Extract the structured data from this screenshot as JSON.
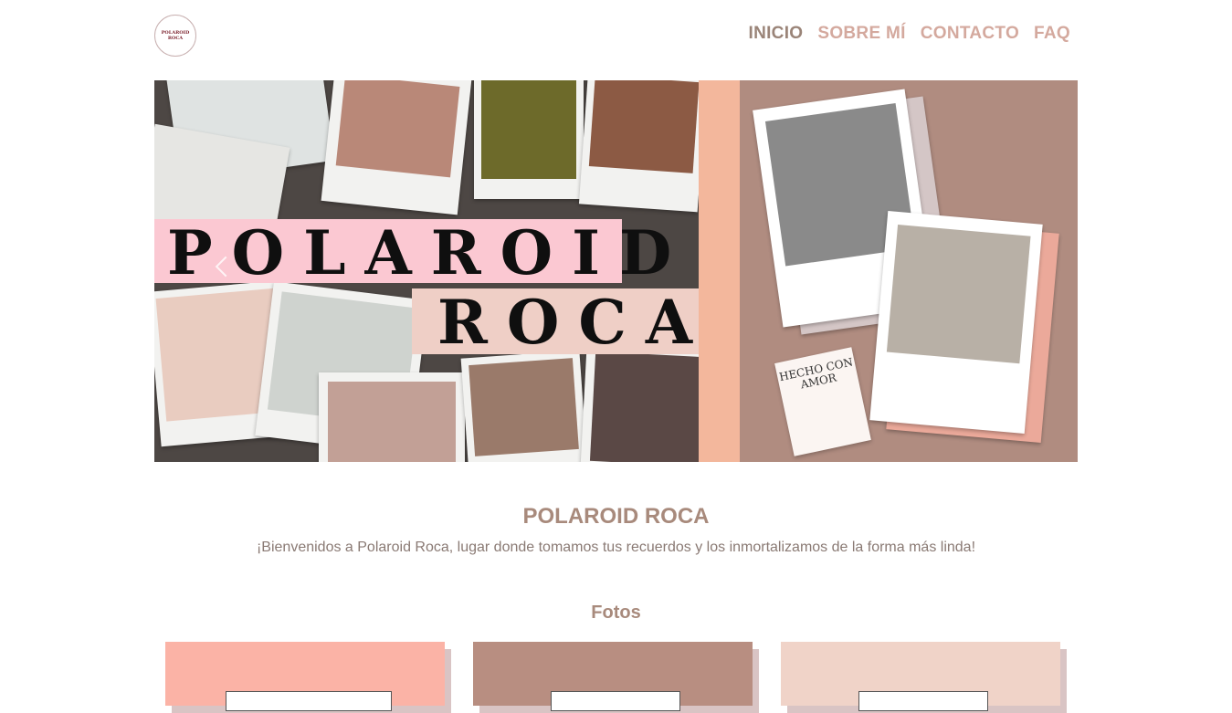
{
  "header": {
    "logo_text": "POLAROID ROCA",
    "nav": [
      {
        "label": "INICIO",
        "active": true
      },
      {
        "label": "SOBRE MÍ",
        "active": false
      },
      {
        "label": "CONTACTO",
        "active": false
      },
      {
        "label": "FAQ",
        "active": false
      }
    ]
  },
  "hero": {
    "title_line1": "POLAROID",
    "title_line2": "ROCA",
    "tag_text": "HECHO CON AMOR"
  },
  "main": {
    "title": "POLAROID ROCA",
    "welcome": "¡Bienvenidos a Polaroid Roca, lugar donde tomamos tus recuerdos y los inmortalizamos de la forma más linda!",
    "section_title": "Fotos"
  },
  "colors": {
    "accent": "#d4a99e",
    "nav_active": "#9a8478",
    "heading": "#a88a7c",
    "card_colors": [
      "#fbb3a6",
      "#b88e81",
      "#f0d3c8"
    ]
  }
}
